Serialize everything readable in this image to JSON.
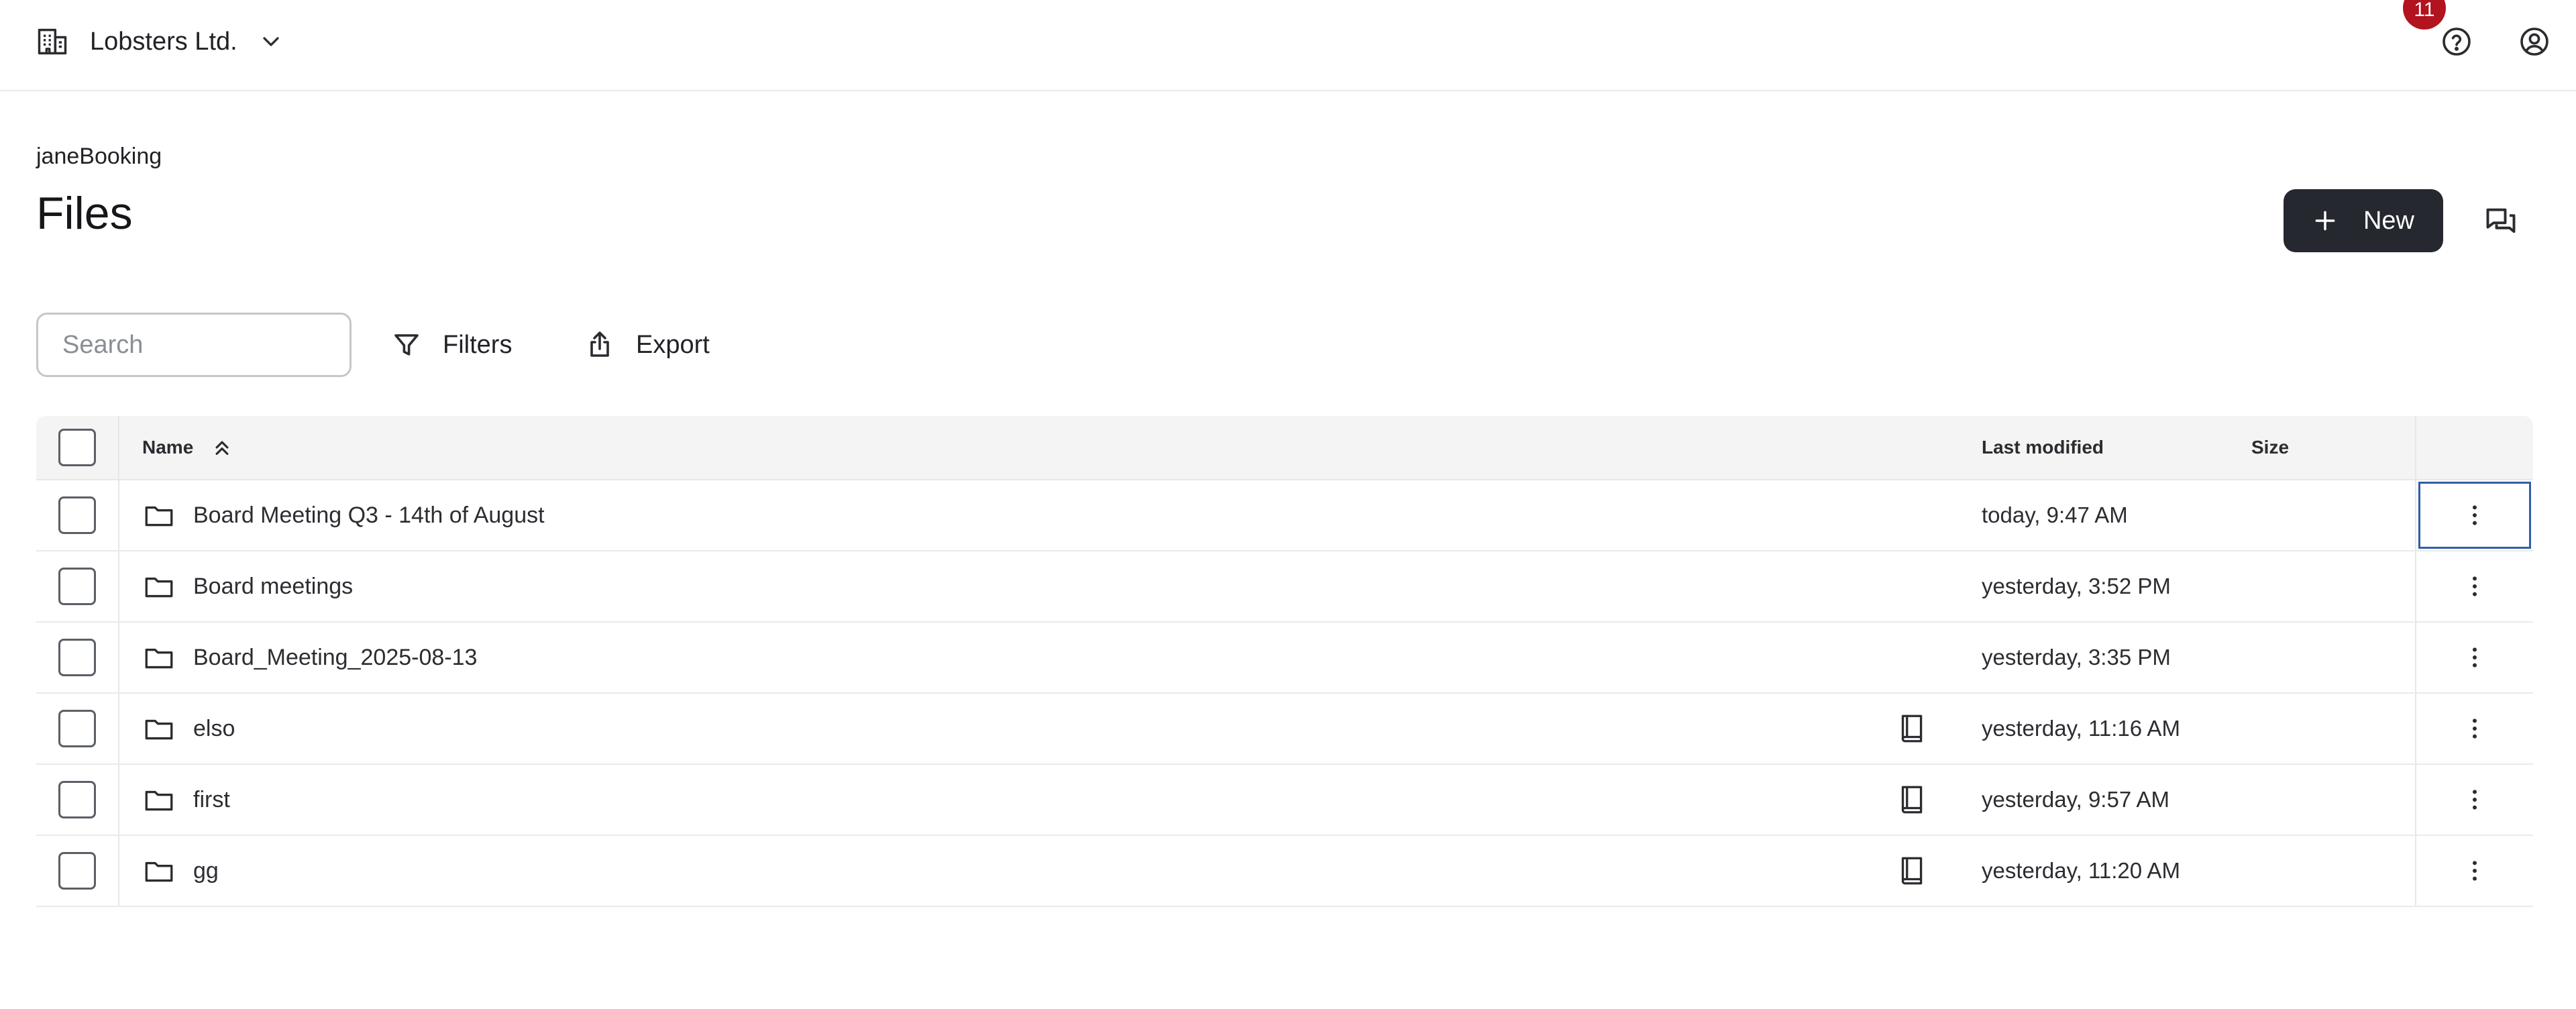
{
  "org": {
    "name": "Lobsters Ltd.",
    "icon": "building-icon"
  },
  "topbar": {
    "notifications_count": "11",
    "help_icon": "help-circle-icon",
    "account_icon": "user-circle-icon"
  },
  "page": {
    "breadcrumb": "janeBooking",
    "title": "Files"
  },
  "actions": {
    "new_label": "New",
    "chat_icon": "chat-bubbles-icon"
  },
  "toolbar": {
    "search_placeholder": "Search",
    "search_value": "",
    "filters_label": "Filters",
    "export_label": "Export"
  },
  "table": {
    "columns": {
      "name": "Name",
      "last_modified": "Last modified",
      "size": "Size"
    },
    "sort": {
      "column": "Name",
      "direction": "ascending"
    },
    "rows": [
      {
        "name": "Board Meeting Q3 - 14th of August",
        "has_book_icon": false,
        "last_modified": "today, 9:47 AM",
        "size": ""
      },
      {
        "name": "Board meetings",
        "has_book_icon": false,
        "last_modified": "yesterday, 3:52 PM",
        "size": ""
      },
      {
        "name": "Board_Meeting_2025-08-13",
        "has_book_icon": false,
        "last_modified": "yesterday, 3:35 PM",
        "size": ""
      },
      {
        "name": "elso",
        "has_book_icon": true,
        "last_modified": "yesterday, 11:16 AM",
        "size": ""
      },
      {
        "name": "first",
        "has_book_icon": true,
        "last_modified": "yesterday, 9:57 AM",
        "size": ""
      },
      {
        "name": "gg",
        "has_book_icon": true,
        "last_modified": "yesterday, 11:20 AM",
        "size": ""
      }
    ]
  },
  "colors": {
    "primary_button": "#25282e",
    "badge": "#b3121f",
    "focus_outline": "#2f5fa7",
    "header_bg": "#f4f4f5"
  }
}
